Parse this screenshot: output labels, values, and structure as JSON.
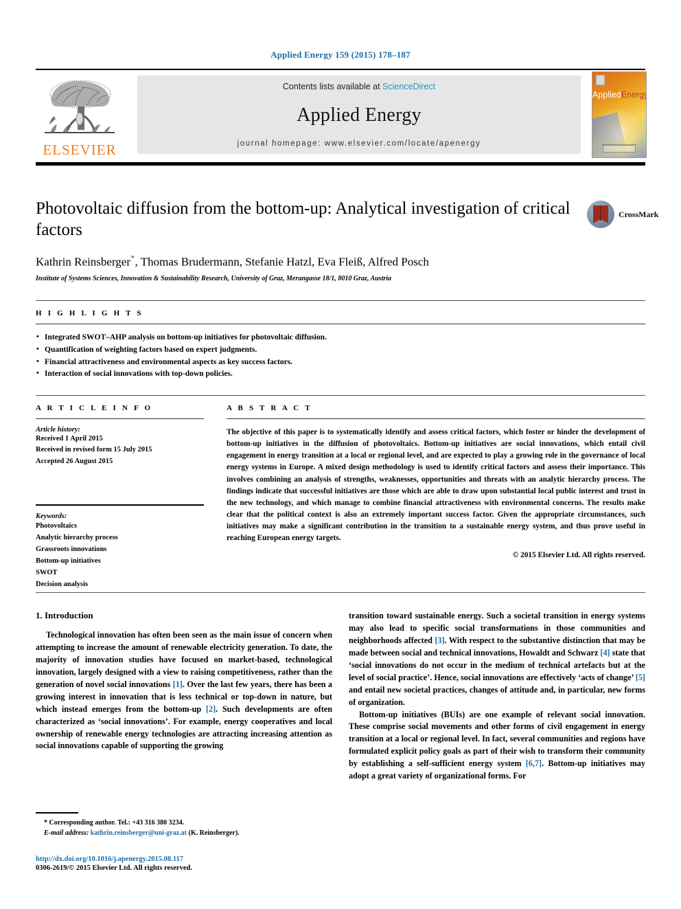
{
  "journal_ref": "Applied Energy 159 (2015) 178–187",
  "masthead": {
    "publisher_name": "ELSEVIER",
    "contents_prefix": "Contents lists available at ",
    "sciencedirect": "ScienceDirect",
    "journal_title": "Applied Energy",
    "homepage": "journal homepage: www.elsevier.com/locate/apenergy",
    "cover": {
      "title_part1": "Applied",
      "title_part2": "Energy"
    }
  },
  "article": {
    "title": "Photovoltaic diffusion from the bottom-up: Analytical investigation of critical factors",
    "authors_before_star": "Kathrin Reinsberger",
    "star": "*",
    "authors_after_star": ", Thomas Brudermann, Stefanie Hatzl, Eva Fleiß, Alfred Posch",
    "affiliation": "Institute of Systems Sciences, Innovation & Sustainability Research, University of Graz, Merangasse 18/1, 8010 Graz, Austria",
    "crossmark_label": "CrossMark"
  },
  "highlights": {
    "heading": "H I G H L I G H T S",
    "items": [
      "Integrated SWOT–AHP analysis on bottom-up initiatives for photovoltaic diffusion.",
      "Quantification of weighting factors based on expert judgments.",
      "Financial attractiveness and environmental aspects as key success factors.",
      "Interaction of social innovations with top-down policies."
    ]
  },
  "article_info": {
    "heading": "A R T I C L E   I N F O",
    "history_label": "Article history:",
    "history": [
      "Received 1 April 2015",
      "Received in revised form 15 July 2015",
      "Accepted 26 August 2015"
    ],
    "keywords_label": "Keywords:",
    "keywords": [
      "Photovoltaics",
      "Analytic hierarchy process",
      "Grassroots innovations",
      "Bottom-up initiatives",
      "SWOT",
      "Decision analysis"
    ]
  },
  "abstract": {
    "heading": "A B S T R A C T",
    "text": "The objective of this paper is to systematically identify and assess critical factors, which foster or hinder the development of bottom-up initiatives in the diffusion of photovoltaics. Bottom-up initiatives are social innovations, which entail civil engagement in energy transition at a local or regional level, and are expected to play a growing role in the governance of local energy systems in Europe. A mixed design methodology is used to identify critical factors and assess their importance. This involves combining an analysis of strengths, weaknesses, opportunities and threats with an analytic hierarchy process. The findings indicate that successful initiatives are those which are able to draw upon substantial local public interest and trust in the new technology, and which manage to combine financial attractiveness with environmental concerns. The results make clear that the political context is also an extremely important success factor. Given the appropriate circumstances, such initiatives may make a significant contribution in the transition to a sustainable energy system, and thus prove useful in reaching European energy targets.",
    "copyright": "© 2015 Elsevier Ltd. All rights reserved."
  },
  "body": {
    "section_title": "1. Introduction",
    "left_para1_a": "Technological innovation has often been seen as the main issue of concern when attempting to increase the amount of renewable electricity generation. To date, the majority of innovation studies have focused on market-based, technological innovation, largely designed with a view to raising competitiveness, rather than the generation of novel social innovations ",
    "left_cit1": "[1]",
    "left_para1_b": ". Over the last few years, there has been a growing interest in innovation that is less technical or top-down in nature, but which instead emerges from the bottom-up ",
    "left_cit2": "[2]",
    "left_para1_c": ". Such developments are often characterized as ‘social innovations’. For example, energy cooperatives and local ownership of renewable energy technologies are attracting increasing attention as social innovations capable of supporting the growing",
    "right_para1_a": "transition toward sustainable energy. Such a societal transition in energy systems may also lead to specific social transformations in those communities and neighborhoods affected ",
    "right_cit3": "[3]",
    "right_para1_b": ". With respect to the substantive distinction that may be made between social and technical innovations, Howaldt and Schwarz ",
    "right_cit4": "[4]",
    "right_para1_c": " state that ‘social innovations do not occur in the medium of technical artefacts but at the level of social practice’. Hence, social innovations are effectively ‘acts of change’ ",
    "right_cit5": "[5]",
    "right_para1_d": " and entail new societal practices, changes of attitude and, in particular, new forms of organization.",
    "right_para2_a": "Bottom-up initiatives (BUIs) are one example of relevant social innovation. These comprise social movements and other forms of civil engagement in energy transition at a local or regional level. In fact, several communities and regions have formulated explicit policy goals as part of their wish to transform their community by establishing a self-sufficient energy system ",
    "right_cit67": "[6,7]",
    "right_para2_b": ". Bottom-up initiatives may adopt a great variety of organizational forms. For"
  },
  "footnote": {
    "corresponding": "* Corresponding author. Tel.: +43 316 380 3234.",
    "email_label": "E-mail address:",
    "email": "kathrin.reinsberger@uni-graz.at",
    "email_suffix": "(K. Reinsberger).",
    "doi": "http://dx.doi.org/10.1016/j.apenergy.2015.08.117",
    "issn": "0306-2619/© 2015 Elsevier Ltd. All rights reserved."
  },
  "colors": {
    "link_blue": "#1b6ca8",
    "sciencedirect_blue": "#2196c4",
    "elsevier_orange": "#F07D1A",
    "banner_gray": "#e6e6e6"
  }
}
